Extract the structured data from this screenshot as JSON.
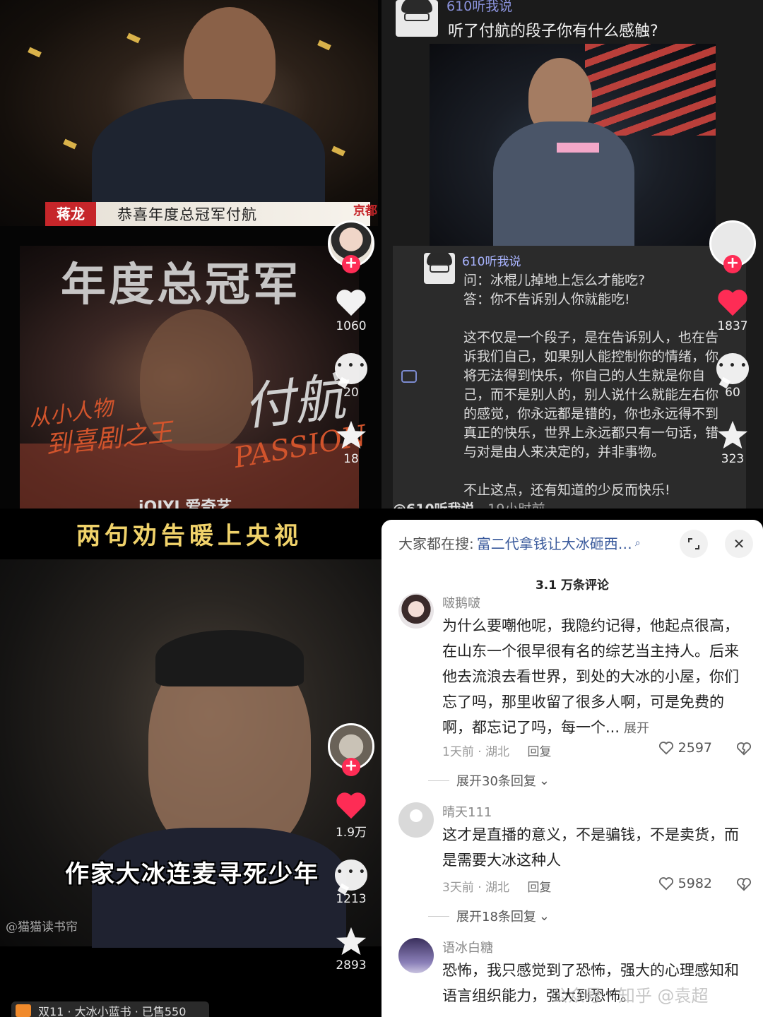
{
  "top_left": {
    "caption_name": "蒋龙",
    "caption_text": "恭喜年度总冠军付航",
    "corner_tag": "京都",
    "big_title": "年度总冠军",
    "script_name": "付航",
    "script_line1": "从小人物",
    "script_line2": "到喜剧之王",
    "passion": "PASSION",
    "logo": "iQIYI 爱奇艺",
    "likes": "1060",
    "comments": "20",
    "favorites": "18"
  },
  "top_right": {
    "author": "610听我说",
    "question": "听了付航的段子你有什么感触?",
    "post_author": "610听我说",
    "post_lines": [
      "问：冰棍儿掉地上怎么才能吃?",
      "答：你不告诉别人你就能吃!",
      "",
      "这不仅是一个段子，是在告诉别人，也在告",
      "诉我们自己，如果别人能控制你的情绪，你",
      "将无法得到快乐，你自己的人生就是你自",
      "己，而不是别人的，别人说什么就能左右你",
      "的感觉，你永远都是错的，你也永远得不到",
      "真正的快乐，世界上永远都只有一句话，错",
      "与对是由人来决定的，并非事物。",
      "",
      "不止这点，还有知道的少反而快乐!"
    ],
    "bottom_author": "@610听我说",
    "bottom_time": "19小时前",
    "likes": "1837",
    "comments": "60",
    "favorites": "323"
  },
  "bottom_left": {
    "title": "两句劝告暖上央视",
    "subtitle": "作家大冰连麦寻死少年",
    "watermark": "@猫猫读书帘",
    "shop": "双11 · 大冰小蓝书 · 已售550",
    "likes": "1.9万",
    "comments": "1213",
    "favorites": "2893"
  },
  "comments_panel": {
    "search_label": "大家都在搜:",
    "search_query": "富二代拿钱让大冰砸西…",
    "count_title": "3.1 万条评论",
    "comments": [
      {
        "name": "啵鹅啵",
        "text": "为什么要嘲他呢，我隐约记得，他起点很高，在山东一个很早很有名的综艺当主持人。后来他去流浪去看世界，到处的大冰的小屋，你们忘了吗，那里收留了很多人啊，可是免费的啊，都忘记了吗，每一个...",
        "more": "展开",
        "time": "1天前 · 湖北",
        "reply": "回复",
        "likes": "2597",
        "expand": "展开30条回复"
      },
      {
        "name": "晴天111",
        "text": "这才是直播的意义，不是骗钱，不是卖货，而是需要大冰这种人",
        "time": "3天前 · 湖北",
        "reply": "回复",
        "likes": "5982",
        "expand": "展开18条回复"
      },
      {
        "name": "语冰白糖",
        "text": "恐怖，我只感觉到了恐怖，强大的心理感知和语言组织能力，强大到恐怖。"
      }
    ],
    "watermark": "公众号 · 知乎 @袁超"
  },
  "colors": {
    "like_red": "#fe2c55",
    "title_gold": "#f0d26a",
    "link_blue": "#3a5a9c"
  }
}
